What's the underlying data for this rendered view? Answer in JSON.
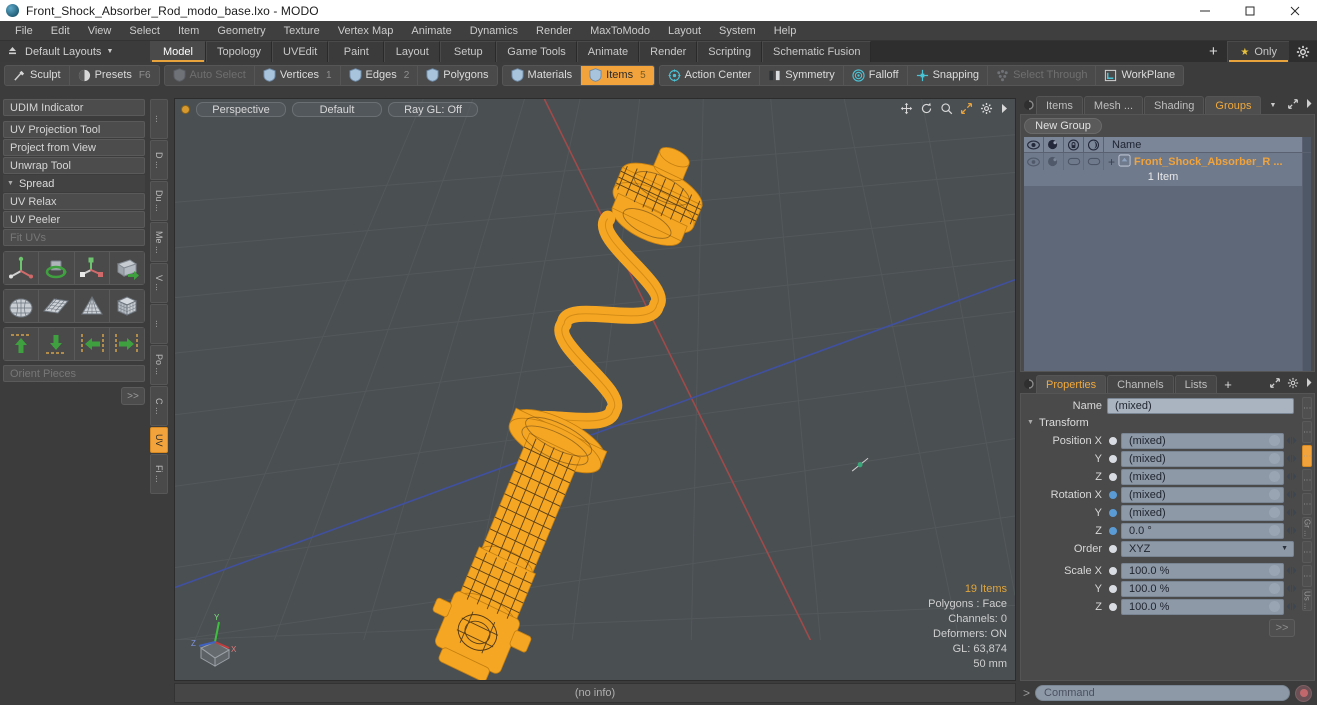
{
  "window": {
    "title": "Front_Shock_Absorber_Rod_modo_base.lxo - MODO",
    "app_icon": "modo-sphere-icon",
    "minimize": "minimize-icon",
    "maximize": "maximize-icon",
    "close": "close-icon"
  },
  "menubar": {
    "items": [
      "File",
      "Edit",
      "View",
      "Select",
      "Item",
      "Geometry",
      "Texture",
      "Vertex Map",
      "Animate",
      "Dynamics",
      "Render",
      "MaxToModo",
      "Layout",
      "System",
      "Help"
    ]
  },
  "layoutbar": {
    "layouts_label": "Default Layouts",
    "tabs": [
      {
        "label": "Model",
        "active": true
      },
      {
        "label": "Topology",
        "active": false
      },
      {
        "label": "UVEdit",
        "active": false
      },
      {
        "label": "Paint",
        "active": false
      },
      {
        "label": "Layout",
        "active": false
      },
      {
        "label": "Setup",
        "active": false
      },
      {
        "label": "Game Tools",
        "active": false
      },
      {
        "label": "Animate",
        "active": false
      },
      {
        "label": "Render",
        "active": false
      },
      {
        "label": "Scripting",
        "active": false
      },
      {
        "label": "Schematic Fusion",
        "active": false
      }
    ],
    "add_tab": "+",
    "only_label": "Only",
    "gear": "gear-icon"
  },
  "modebar": {
    "left_group": [
      {
        "label": "Sculpt",
        "icon": "brush-icon",
        "state": "normal",
        "shortcut": ""
      },
      {
        "label": "Presets",
        "icon": "sphere-icon",
        "state": "normal",
        "shortcut": "F6"
      }
    ],
    "select_group": [
      {
        "label": "Auto Select",
        "icon": "shield-icon",
        "state": "disabled",
        "count": ""
      },
      {
        "label": "Vertices",
        "icon": "shield-icon",
        "state": "normal",
        "count": "1"
      },
      {
        "label": "Edges",
        "icon": "shield-icon",
        "state": "normal",
        "count": "2"
      },
      {
        "label": "Polygons",
        "icon": "shield-icon",
        "state": "normal",
        "count": ""
      }
    ],
    "item_group": [
      {
        "label": "Materials",
        "icon": "shield-icon",
        "state": "normal",
        "count": ""
      },
      {
        "label": "Items",
        "icon": "shield-icon",
        "state": "active",
        "count": "5"
      }
    ],
    "tools_group": [
      {
        "label": "Action Center",
        "icon": "target-icon",
        "state": "normal"
      },
      {
        "label": "Symmetry",
        "icon": "mirror-icon",
        "state": "normal"
      },
      {
        "label": "Falloff",
        "icon": "falloff-icon",
        "state": "normal"
      },
      {
        "label": "Snapping",
        "icon": "snap-icon",
        "state": "normal"
      },
      {
        "label": "Select Through",
        "icon": "select-through-icon",
        "state": "disabled"
      },
      {
        "label": "WorkPlane",
        "icon": "workplane-icon",
        "state": "normal"
      }
    ]
  },
  "leftpanel": {
    "buttons_top": [
      {
        "label": "UDIM Indicator",
        "dim": false
      }
    ],
    "buttons_mid": [
      {
        "label": "UV Projection Tool",
        "dim": false
      },
      {
        "label": "Project from View",
        "dim": false
      },
      {
        "label": "Unwrap Tool",
        "dim": false
      }
    ],
    "group_label": "Spread",
    "buttons_after": [
      {
        "label": "UV Relax",
        "dim": false
      },
      {
        "label": "UV Peeler",
        "dim": false
      },
      {
        "label": "Fit UVs",
        "dim": true
      }
    ],
    "icon_row_1": [
      "move-uv-icon",
      "rotate-uv-icon",
      "scale-uv-icon",
      "flip-uv-icon"
    ],
    "icon_row_2": [
      "uv-sphere-icon",
      "uv-plane-icon",
      "uv-cone-icon",
      "uv-cube-icon"
    ],
    "icon_row_3": [
      "align-up-icon",
      "align-down-icon",
      "align-left-icon",
      "align-right-icon"
    ],
    "orient_label": "Orient Pieces",
    "expand_label": ">>",
    "vtabs": [
      {
        "label": "...",
        "active": false
      },
      {
        "label": "D ...",
        "active": false
      },
      {
        "label": "Du ...",
        "active": false
      },
      {
        "label": "Me ...",
        "active": false
      },
      {
        "label": "V ...",
        "active": false
      },
      {
        "label": "...",
        "active": false
      },
      {
        "label": "Po ...",
        "active": false
      },
      {
        "label": "C ...",
        "active": false
      },
      {
        "label": "UV",
        "active": true
      },
      {
        "label": "Fi ...",
        "active": false
      }
    ]
  },
  "viewport": {
    "view_mode": "Perspective",
    "shading": "Default",
    "raygl": "Ray GL: Off",
    "tool_icons": [
      "pan-icon",
      "rotate-icon",
      "zoom-icon",
      "fit-icon",
      "gear-icon",
      "chevron-right-icon"
    ],
    "stats": {
      "items": "19 Items",
      "polygons": "Polygons : Face",
      "channels": "Channels: 0",
      "deformers": "Deformers: ON",
      "gl": "GL: 63,874",
      "scale": "50 mm"
    },
    "axis_gizmo": "axis-gizmo-icon",
    "model_name": "front-shock-absorber-wireframe",
    "colors": {
      "background": "#4a4f52",
      "model": "#f5a623",
      "x_axis": "#a05050",
      "z_axis": "#4a63a8"
    },
    "statusbar": "(no info)"
  },
  "rightpanel": {
    "top_tabs": [
      {
        "label": "Items",
        "active": false
      },
      {
        "label": "Mesh ...",
        "active": false
      },
      {
        "label": "Shading",
        "active": false
      },
      {
        "label": "Groups",
        "active": true
      }
    ],
    "groups": {
      "new_group_label": "New Group",
      "columns": [
        "eye-icon",
        "render-icon",
        "lock-icon",
        "select-icon",
        "Name"
      ],
      "rows": [
        {
          "name": "Front_Shock_Absorber_R ...",
          "sub": "1 Item",
          "icon": "group-icon"
        }
      ]
    },
    "props_tabs": [
      {
        "label": "Properties",
        "active": true
      },
      {
        "label": "Channels",
        "active": false
      },
      {
        "label": "Lists",
        "active": false
      }
    ],
    "props_add": "+",
    "properties": {
      "name_label": "Name",
      "name_value": "(mixed)",
      "transform_label": "Transform",
      "fields": [
        {
          "label": "Position X",
          "value": "(mixed)",
          "radio": "white"
        },
        {
          "label": "Y",
          "value": "(mixed)",
          "radio": "white"
        },
        {
          "label": "Z",
          "value": "(mixed)",
          "radio": "white"
        },
        {
          "label": "Rotation X",
          "value": "(mixed)",
          "radio": "blue"
        },
        {
          "label": "Y",
          "value": "(mixed)",
          "radio": "blue"
        },
        {
          "label": "Z",
          "value": "0.0 °",
          "radio": "blue"
        }
      ],
      "order_label": "Order",
      "order_value": "XYZ",
      "scale_fields": [
        {
          "label": "Scale X",
          "value": "100.0 %",
          "radio": "white"
        },
        {
          "label": "Y",
          "value": "100.0 %",
          "radio": "white"
        },
        {
          "label": "Z",
          "value": "100.0 %",
          "radio": "white"
        }
      ],
      "expand_label": ">>"
    },
    "rail": [
      {
        "label": "",
        "active": false
      },
      {
        "label": "",
        "active": false
      },
      {
        "label": "",
        "active": true
      },
      {
        "label": "",
        "active": false
      },
      {
        "label": "",
        "active": false
      },
      {
        "label": "Gr ...",
        "active": false
      },
      {
        "label": "",
        "active": false
      },
      {
        "label": "",
        "active": false
      },
      {
        "label": "Us ...",
        "active": false
      }
    ]
  },
  "commandbar": {
    "prefix": ">",
    "placeholder": "Command",
    "record_icon": "record-icon"
  }
}
